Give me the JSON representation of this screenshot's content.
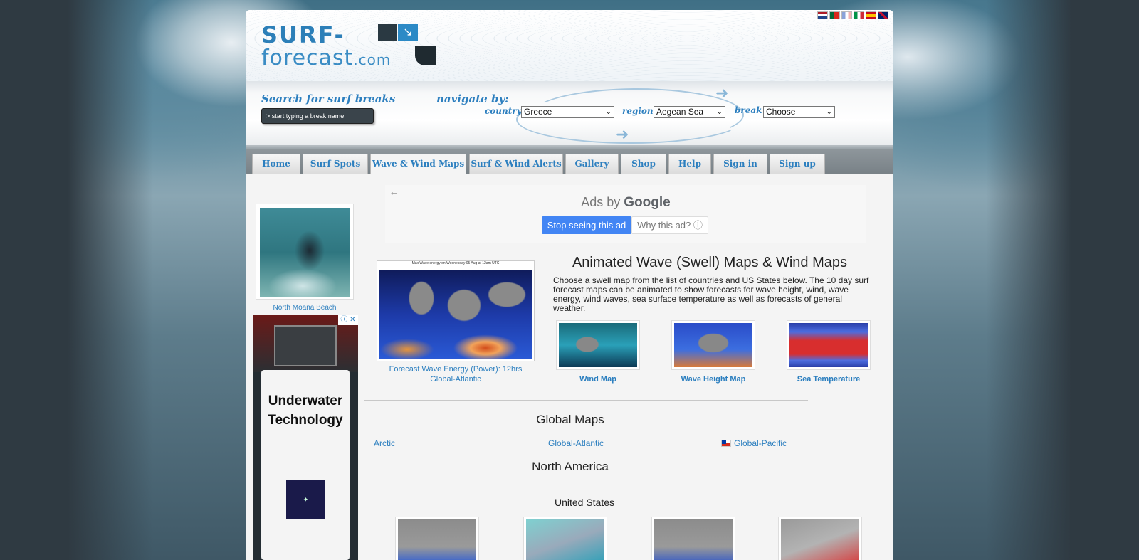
{
  "logo": {
    "line1": "SURF-",
    "line2": "forecast",
    "com": ".com"
  },
  "flags": [
    "nl",
    "pt",
    "fr",
    "it",
    "es",
    "gb"
  ],
  "search": {
    "title": "Search for surf breaks",
    "placeholder": "> start typing a break name"
  },
  "navigate": {
    "title": "navigate by:",
    "country_label": "country",
    "country_value": "Greece",
    "region_label": "region",
    "region_value": "Aegean Sea",
    "break_label": "break",
    "break_value": "Choose"
  },
  "tabs": [
    {
      "label": "Home"
    },
    {
      "label": "Surf Spots"
    },
    {
      "label": "Wave & Wind Maps",
      "active": true
    },
    {
      "label": "Surf & Wind Alerts"
    },
    {
      "label": "Gallery"
    },
    {
      "label": "Shop"
    },
    {
      "label": "Help"
    },
    {
      "label": "Sign in"
    },
    {
      "label": "Sign up"
    }
  ],
  "sidebar": {
    "photo_caption": "North Moana Beach",
    "ad": {
      "heading": "Underwater Technology",
      "close": "ⓘ ✕"
    }
  },
  "google_ad": {
    "prefix": "Ads by ",
    "brand": "Google",
    "stop": "Stop seeing this ad",
    "why": "Why this ad? ⓘ"
  },
  "main": {
    "map_header": "Max Wave energy on Wednesday 05 Aug at 12am UTC",
    "map_caption_1": "Forecast Wave Energy (Power): 12hrs",
    "map_caption_2": "Global-Atlantic",
    "title": "Animated Wave (Swell) Maps & Wind Maps",
    "intro": "Choose a swell map from the list of countries and US States below. The 10 day surf forecast maps can be animated to show forecasts for wave height, wind, wave energy, wind waves, sea surface temperature as well as forecasts of general weather.",
    "thumbs": [
      {
        "label": "Wind Map"
      },
      {
        "label": "Wave Height Map"
      },
      {
        "label": "Sea Temperature"
      }
    ]
  },
  "global_maps": {
    "title": "Global Maps",
    "links": [
      "Arctic",
      "Global-Atlantic",
      "Global-Pacific"
    ]
  },
  "north_america": {
    "title": "North America",
    "subtitle": "United States"
  },
  "colors": {
    "link": "#2c7fbf",
    "tab_bar": "#7d868b",
    "google_blue": "#4285f4"
  }
}
